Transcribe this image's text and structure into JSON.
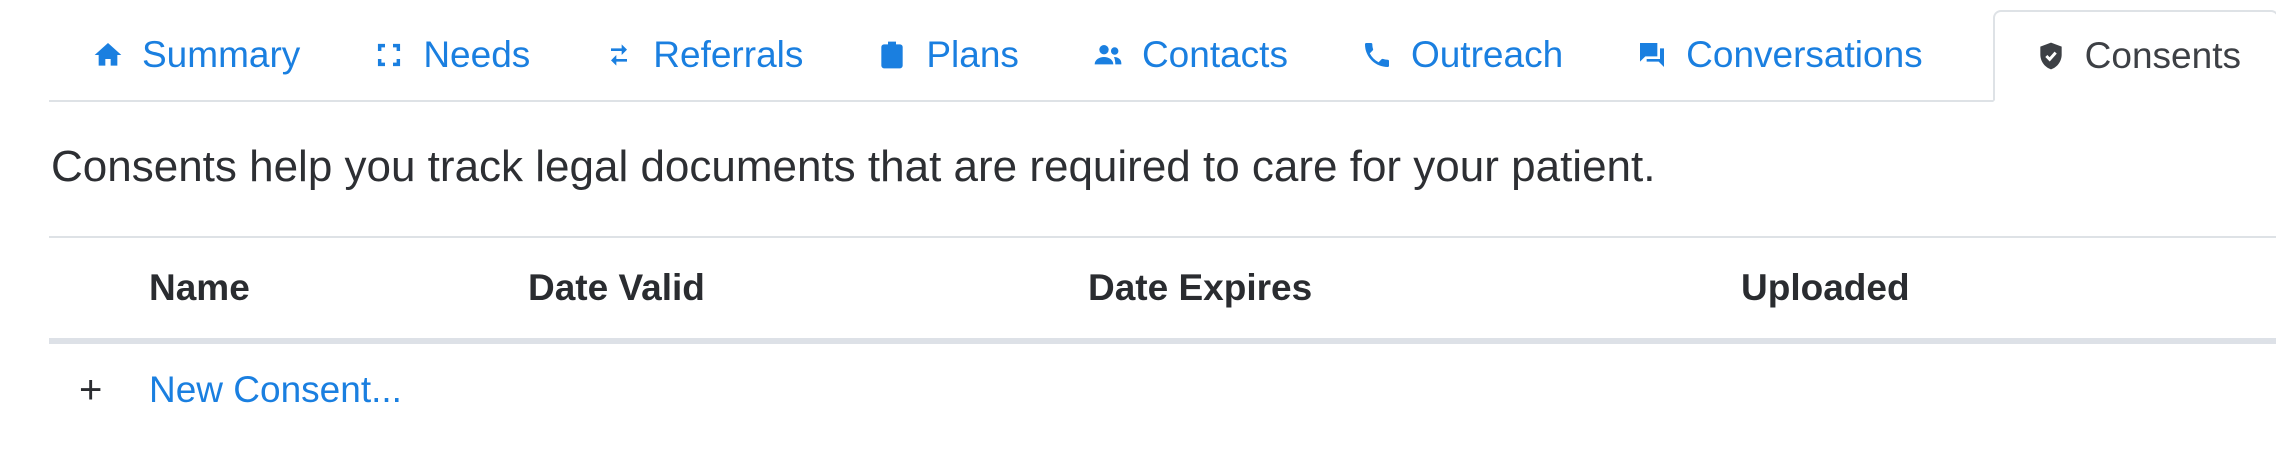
{
  "tabs": [
    {
      "label": "Summary",
      "icon": "home-icon",
      "active": false
    },
    {
      "label": "Needs",
      "icon": "focus-corners-icon",
      "active": false
    },
    {
      "label": "Referrals",
      "icon": "swap-arrows-icon",
      "active": false
    },
    {
      "label": "Plans",
      "icon": "clipboard-icon",
      "active": false
    },
    {
      "label": "Contacts",
      "icon": "people-icon",
      "active": false
    },
    {
      "label": "Outreach",
      "icon": "phone-icon",
      "active": false
    },
    {
      "label": "Conversations",
      "icon": "chat-bubbles-icon",
      "active": false
    },
    {
      "label": "Consents",
      "icon": "shield-check-icon",
      "active": true
    }
  ],
  "description": "Consents help you track legal documents that are required to care for your patient.",
  "table": {
    "columns": [
      "Name",
      "Date Valid",
      "Date Expires",
      "Uploaded"
    ],
    "rows": []
  },
  "new_consent": {
    "plus": "+",
    "label": "New Consent..."
  },
  "colors": {
    "link": "#1a7fe0",
    "active_tab_text": "#3d4045",
    "border": "#dee2e6"
  }
}
